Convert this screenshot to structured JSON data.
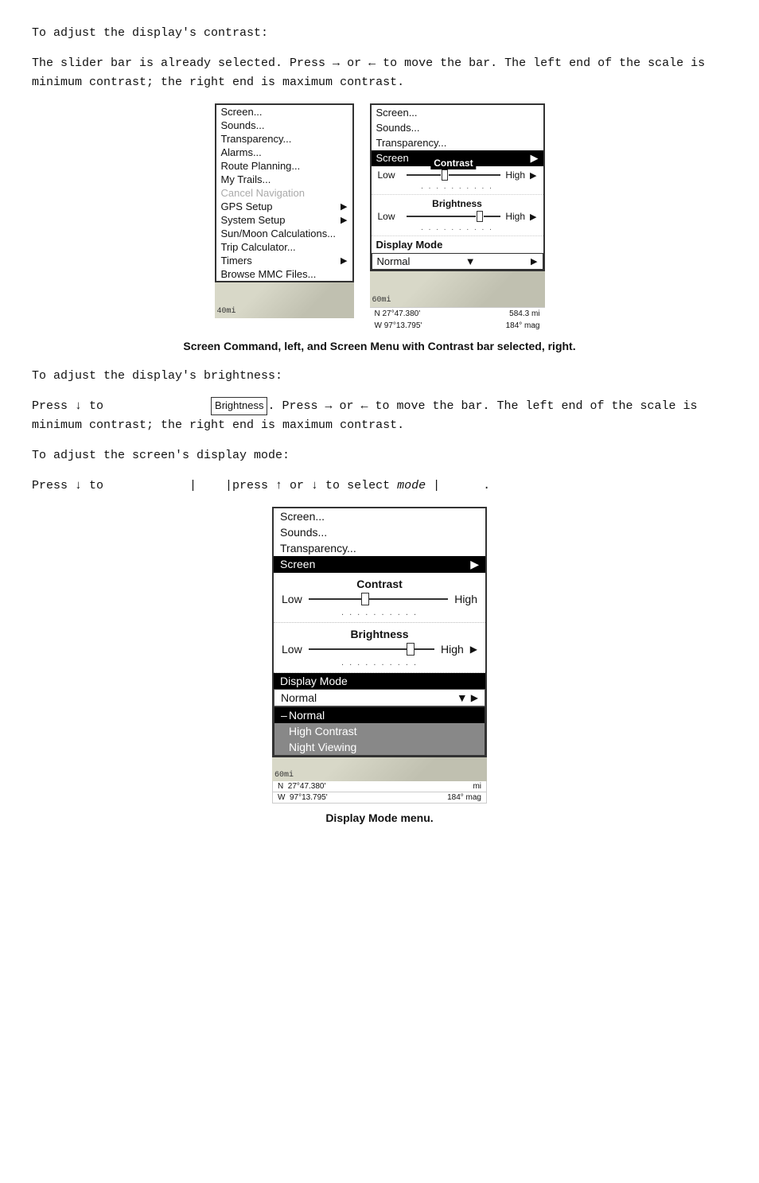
{
  "page": {
    "intro_para": "To adjust the display's contrast:",
    "contrast_desc": "The            slider bar is already selected. Press → or ← to move the bar. The left end of the scale is minimum contrast; the right end is maximum contrast.",
    "caption1": "Screen Command, left, and Screen Menu with Contrast bar selected, right.",
    "brightness_heading": "To adjust the display's brightness:",
    "brightness_desc": "Press ↓ to                  . Press → or ← to move the bar. The left end of the scale is minimum contrast; the right end is maximum contrast.",
    "display_mode_heading": "To adjust the screen's display mode:",
    "display_mode_desc_prefix": "Press ↓ to",
    "display_mode_desc_pipe1": "|",
    "display_mode_desc_pipe2": "|press ↑ or ↓ to select",
    "display_mode_desc_mode": "mode",
    "display_mode_desc_pipe3": "|",
    "display_mode_desc_end": ".",
    "caption2": "Display Mode menu."
  },
  "left_menu": {
    "items": [
      {
        "label": "Screen...",
        "selected": false,
        "grayed": false,
        "arrow": false
      },
      {
        "label": "Sounds...",
        "selected": false,
        "grayed": false,
        "arrow": false
      },
      {
        "label": "Transparency...",
        "selected": false,
        "grayed": false,
        "arrow": false
      },
      {
        "label": "Alarms...",
        "selected": false,
        "grayed": false,
        "arrow": false
      },
      {
        "label": "Route Planning...",
        "selected": false,
        "grayed": false,
        "arrow": false
      },
      {
        "label": "My Trails...",
        "selected": false,
        "grayed": false,
        "arrow": false
      },
      {
        "label": "Cancel Navigation",
        "selected": false,
        "grayed": true,
        "arrow": false
      },
      {
        "label": "GPS Setup",
        "selected": false,
        "grayed": false,
        "arrow": true
      },
      {
        "label": "System Setup",
        "selected": false,
        "grayed": false,
        "arrow": true
      },
      {
        "label": "Sun/Moon Calculations...",
        "selected": false,
        "grayed": false,
        "arrow": false
      },
      {
        "label": "Trip Calculator...",
        "selected": false,
        "grayed": false,
        "arrow": false
      },
      {
        "label": "Timers",
        "selected": false,
        "grayed": false,
        "arrow": true
      },
      {
        "label": "Browse MMC Files...",
        "selected": false,
        "grayed": false,
        "arrow": false
      }
    ]
  },
  "right_screen_menu": {
    "header_items": [
      {
        "label": "Screen..."
      },
      {
        "label": "Sounds..."
      },
      {
        "label": "Transparency..."
      }
    ],
    "screen_selected_label": "Screen",
    "contrast_label": "Contrast",
    "low_label": "Low",
    "high_label": "High",
    "dots": "...........",
    "brightness_label": "Brightness",
    "brightness_low": "Low",
    "brightness_high": "High",
    "brightness_dots": "...........",
    "display_mode_label": "Display Mode",
    "normal_value": "Normal",
    "coords_n": "27°47.380'",
    "coords_w": "97°13.795'",
    "dist": "584.3 mi",
    "mag": "184° mag",
    "scale_left": "60mi",
    "scale_left2": "40mi"
  },
  "large_menu": {
    "header_items": [
      {
        "label": "Screen..."
      },
      {
        "label": "Sounds..."
      },
      {
        "label": "Transparency..."
      }
    ],
    "screen_selected_label": "Screen",
    "contrast_label": "Contrast",
    "low_label": "Low",
    "high_label": "High",
    "dots": "...........",
    "brightness_label": "Brightness",
    "brightness_low": "Low",
    "brightness_high": "High",
    "brightness_dots": "...........",
    "display_mode_label": "Display Mode",
    "normal_value": "Normal",
    "dropdown_options": [
      {
        "label": "Normal",
        "active": true,
        "bullet": "–"
      },
      {
        "label": "High Contrast",
        "active": false,
        "bullet": ""
      },
      {
        "label": "Night Viewing",
        "active": false,
        "bullet": ""
      }
    ],
    "coords_n": "27°47.380'",
    "coords_w": "97°13.795'",
    "mag": "184° mag",
    "scale": "60mi",
    "dist_label": "mi"
  }
}
